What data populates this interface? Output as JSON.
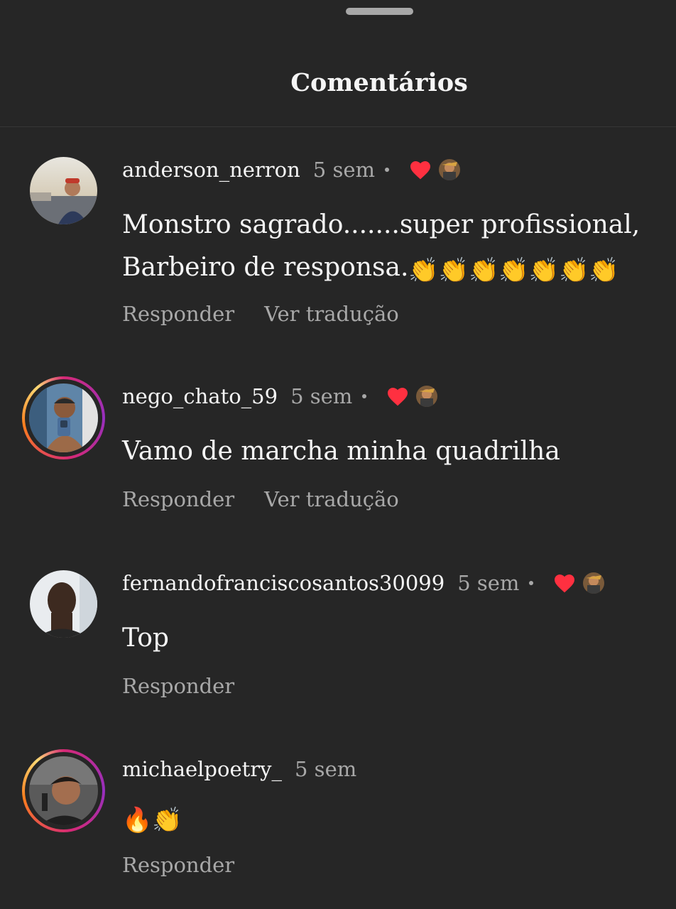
{
  "header": {
    "title": "Comentários"
  },
  "comments": [
    {
      "username": "anderson_nerron",
      "time": "5 sem",
      "text_line1": "Monstro sagrado.......super profissional,",
      "text_line2": "Barbeiro de responsa.",
      "text_emojis": "👏👏👏👏👏👏👏",
      "reply_label": "Responder",
      "translate_label": "Ver tradução",
      "liked_by_author": true
    },
    {
      "username": "nego_chato_59",
      "time": "5 sem",
      "text_line1": "Vamo de marcha minha quadrilha",
      "reply_label": "Responder",
      "translate_label": "Ver tradução",
      "liked_by_author": true
    },
    {
      "username": "fernandofranciscosantos30099",
      "time": "5 sem",
      "text_line1": "Top",
      "reply_label": "Responder",
      "liked_by_author": true
    },
    {
      "username": "michaelpoetry_",
      "time": "5 sem",
      "text_emojis": "🔥👏",
      "reply_label": "Responder",
      "liked_by_author": false
    }
  ],
  "colors": {
    "background": "#262626",
    "text": "#f5f5f5",
    "muted": "#a8a8a8",
    "heart": "#ff3040",
    "story_ring_start": "#d62976",
    "story_ring_end": "#fa7e1e"
  },
  "icons": {
    "heart": "heart-icon",
    "drag_handle": "drag-handle-icon"
  }
}
